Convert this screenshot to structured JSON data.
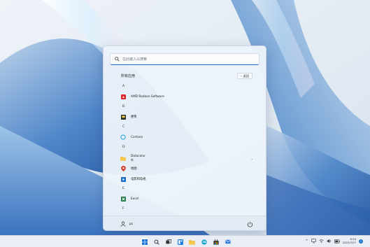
{
  "search": {
    "placeholder": "在此键入以搜索"
  },
  "list": {
    "title": "所有应用",
    "back_label": "返回",
    "sections": [
      {
        "letter": "A"
      },
      {
        "letter": "B"
      },
      {
        "letter": "C"
      },
      {
        "letter": "D"
      },
      {
        "letter": "E"
      },
      {
        "letter": "F"
      }
    ],
    "apps": [
      {
        "name": "AMD Radeon Software"
      },
      {
        "name": "便笺"
      },
      {
        "name": "Cortana"
      },
      {
        "name": "Datacolor",
        "subtitle": "新"
      },
      {
        "name": "地图"
      },
      {
        "name": "电影和电视"
      },
      {
        "name": "Excel"
      }
    ]
  },
  "footer": {
    "user_name": "pc"
  },
  "taskbar": {
    "time": "9:34",
    "date": "2022/7/27",
    "notification_count": "1",
    "tray_chevron": "^"
  },
  "colors": {
    "accent": "#1f6fc9",
    "menu_bg": "#ecf2fa"
  }
}
